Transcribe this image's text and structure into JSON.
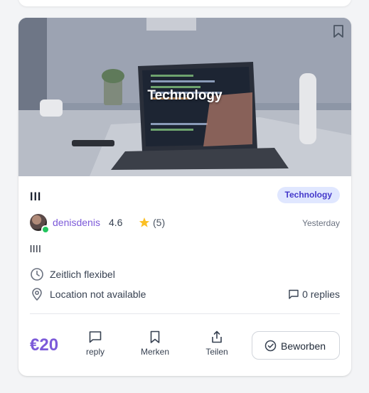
{
  "listing": {
    "image_caption": "Technology",
    "title": "lll",
    "category": "Technology",
    "author": {
      "name": "denisdenis",
      "rating": "4.6",
      "review_count": "(5)",
      "online": true
    },
    "date": "Yesterday",
    "description": "llll",
    "time_text": "Zeitlich flexibel",
    "location_text": "Location not available",
    "replies_text": "0 replies",
    "price": "€20"
  },
  "actions": {
    "reply_label": "reply",
    "bookmark_label": "Merken",
    "share_label": "Teilen",
    "apply_label": "Beworben"
  },
  "icons": {
    "bookmark": "bookmark-icon",
    "star": "star-icon",
    "clock": "clock-icon",
    "location": "map-pin-icon",
    "comment": "comment-icon",
    "share": "share-icon",
    "check": "check-circle-icon"
  },
  "colors": {
    "accent": "#7c5ad9",
    "badge_bg": "#e0e7ff",
    "badge_text": "#4338ca",
    "online": "#22c55e",
    "star": "#fbbf24"
  }
}
